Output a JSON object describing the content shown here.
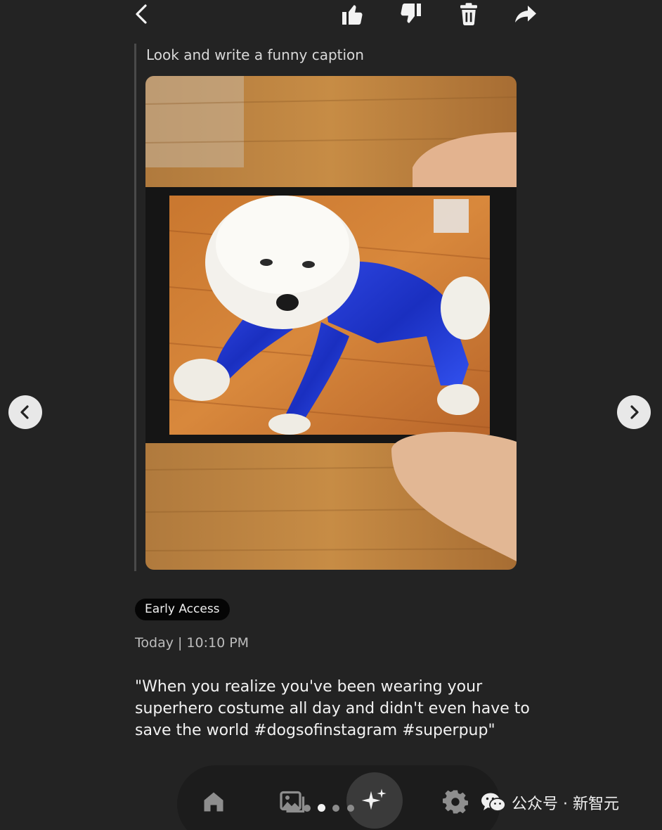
{
  "header": {
    "back_icon": "chevron-left-icon",
    "actions": [
      {
        "name": "thumbs-up-icon"
      },
      {
        "name": "thumbs-down-icon"
      },
      {
        "name": "trash-icon"
      },
      {
        "name": "share-icon"
      }
    ]
  },
  "conversation": {
    "prompt": "Look and write a funny caption",
    "image_description_icon": "photo-dog-in-blue-suit"
  },
  "result": {
    "badge": "Early Access",
    "timestamp": "Today | 10:10 PM",
    "caption": "\"When you realize you've been wearing your superhero costume all day and didn't even have to save the world #dogsofinstagram #superpup\""
  },
  "carousel": {
    "prev_icon": "chevron-left-icon",
    "next_icon": "chevron-right-icon",
    "page_count": 4,
    "active_index": 1
  },
  "bottom_nav": {
    "items": [
      {
        "name": "home-icon"
      },
      {
        "name": "gallery-icon"
      },
      {
        "name": "sparkle-icon"
      },
      {
        "name": "settings-icon"
      }
    ]
  },
  "watermark": {
    "text": "公众号 · 新智元",
    "icon": "wechat-icon"
  },
  "colors": {
    "background": "#232323",
    "text": "#f2f2f2",
    "muted": "#bdbdbd",
    "badge_bg": "#050505"
  }
}
